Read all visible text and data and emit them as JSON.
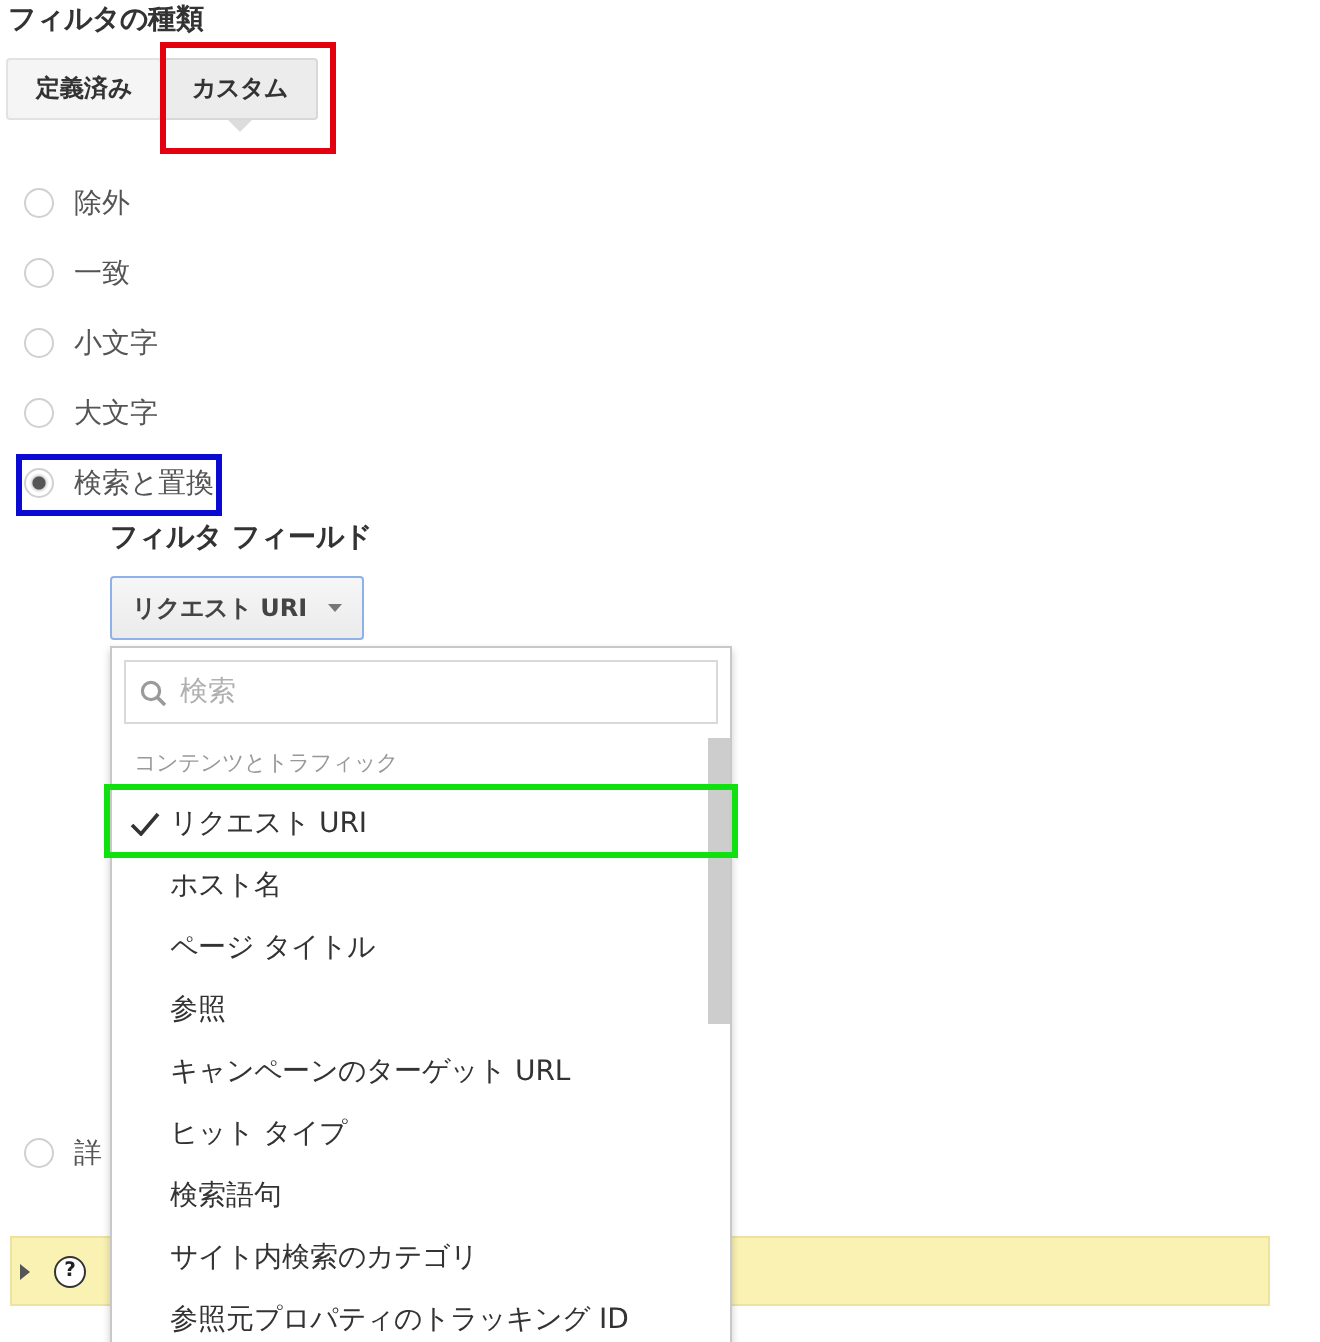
{
  "filter_type": {
    "title": "フィルタの種類",
    "tabs": [
      {
        "label": "定義済み",
        "selected": false
      },
      {
        "label": "カスタム",
        "selected": true,
        "frame": {
          "color": "#e3000f"
        }
      }
    ]
  },
  "options": [
    {
      "label": "除外",
      "selected": false
    },
    {
      "label": "一致",
      "selected": false
    },
    {
      "label": "小文字",
      "selected": false
    },
    {
      "label": "大文字",
      "selected": false
    },
    {
      "label": "検索と置換",
      "selected": true,
      "frame": {
        "color": "#0a0ad2"
      },
      "details": {
        "label": "フィルタ フィールド",
        "dropdown": {
          "value": "リクエスト URI",
          "expanded": true,
          "menu": {
            "search": {
              "placeholder": "検索"
            },
            "group": "コンテンツとトラフィック",
            "items": [
              {
                "label": "リクエスト URI",
                "selected": true,
                "frame": {
                  "color": "#10e010"
                }
              },
              {
                "label": "ホスト名",
                "selected": false
              },
              {
                "label": "ページ タイトル",
                "selected": false
              },
              {
                "label": "参照",
                "selected": false
              },
              {
                "label": "キャンペーンのターゲット URL",
                "selected": false
              },
              {
                "label": "ヒット タイプ",
                "selected": false
              },
              {
                "label": "検索語句",
                "selected": false
              },
              {
                "label": "サイト内検索のカテゴリ",
                "selected": false
              },
              {
                "label": "参照元プロパティのトラッキング ID",
                "selected": false
              }
            ]
          }
        }
      }
    },
    {
      "label": "詳",
      "selected": false
    }
  ],
  "help_bar": {
    "expanded": false,
    "icon": "?"
  }
}
